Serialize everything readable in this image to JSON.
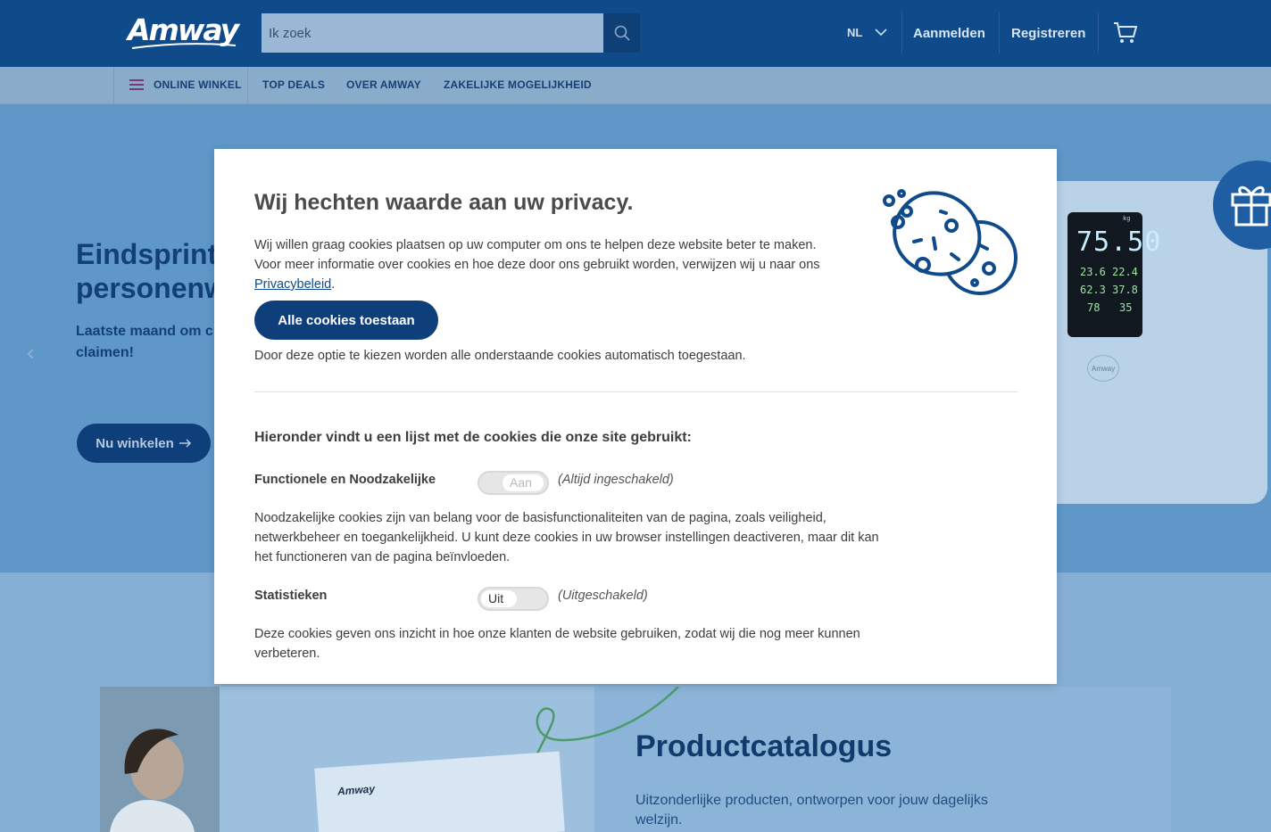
{
  "header": {
    "logo_text": "Amway",
    "search_placeholder": "Ik zoek",
    "language": "NL",
    "login_label": "Aanmelden",
    "register_label": "Registreren"
  },
  "nav": {
    "items": [
      "ONLINE WINKEL",
      "TOP DEALS",
      "OVER AMWAY",
      "ZAKELIJKE MOGELIJKHEID"
    ]
  },
  "hero": {
    "title_line1": "Eindsprint",
    "title_line2": "personenw",
    "subtitle_line1": "Laatste maand om c",
    "subtitle_line2": "claimen!",
    "button_label": "Nu winkelen",
    "scale_readout": "75.50",
    "scale_unit": "kg",
    "scale_values": [
      "23.6",
      "22.4",
      "62.3",
      "37.8",
      "78",
      "35"
    ],
    "scale_brand": "Amway"
  },
  "catalog": {
    "book_title": "Amway",
    "title": "Productcatalogus",
    "text": "Uitzonderlijke producten, ontworpen voor jouw dagelijks welzijn."
  },
  "modal": {
    "title": "Wij hechten waarde aan uw privacy.",
    "intro_before_link": "Wij willen graag cookies plaatsen op uw computer om ons te helpen deze website beter te maken. Voor meer informatie over cookies en hoe deze door ons gebruikt worden, verwijzen wij u naar ons ",
    "privacy_link": "Privacybeleid",
    "intro_after_link": ".",
    "accept_all_label": "Alle cookies toestaan",
    "accept_note": "Door deze optie te kiezen worden alle onderstaande cookies automatisch toegestaan.",
    "list_heading": "Hieronder vindt u een lijst met de cookies die onze site gebruikt:",
    "categories": [
      {
        "name": "Functionele en Noodzakelijke",
        "toggle_label": "Aan",
        "state": "(Altijd ingeschakeld)",
        "description": "Noodzakelijke cookies zijn van belang voor de basisfunctionaliteiten van de pagina, zoals veiligheid, netwerkbeheer en toegankelijkheid. U kunt deze cookies in uw browser instellingen deactiveren, maar dit kan het functioneren van de pagina beïnvloeden."
      },
      {
        "name": "Statistieken",
        "toggle_label": "Uit",
        "state": "(Uitgeschakeld)",
        "description": "Deze cookies geven ons inzicht in hoe onze klanten de website gebruiken, zodat wij die nog meer kunnen verbeteren."
      }
    ]
  },
  "colors": {
    "brand_blue": "#0f4a8a",
    "button_blue": "#0f3f7a",
    "cookie_icon_blue": "#0f4a8a"
  }
}
